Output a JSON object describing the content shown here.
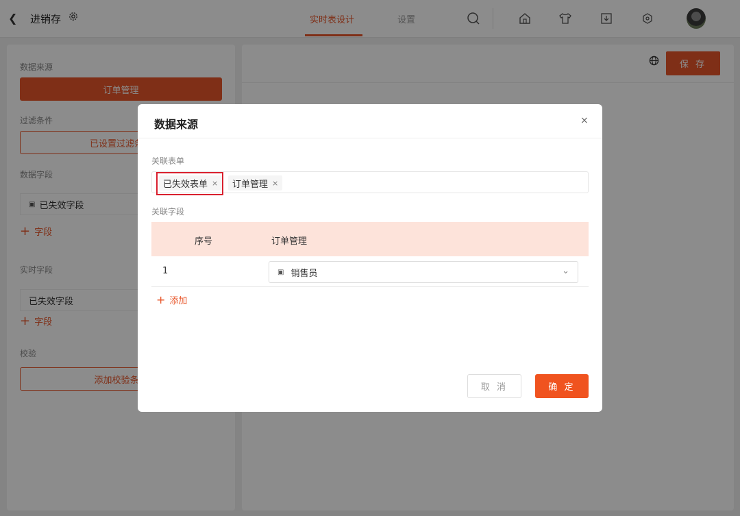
{
  "header": {
    "back_icon": "chevron-left",
    "title": "进销存",
    "settings_icon": "gear",
    "tabs": [
      {
        "label": "实时表设计",
        "active": true
      },
      {
        "label": "设置",
        "active": false
      }
    ],
    "icons": [
      "search",
      "home",
      "shirt",
      "download",
      "hexagon"
    ],
    "accent_color": "#e8562a"
  },
  "left_panel": {
    "data_source_label": "数据来源",
    "data_source_value": "订单管理",
    "filter_label": "过滤条件",
    "filter_button": "已设置过滤条件",
    "data_fields_label": "数据字段",
    "data_field_item": "已失效字段",
    "add_field_1": "字段",
    "realtime_fields_label": "实时字段",
    "realtime_field_item": "已失效字段",
    "add_field_2": "字段",
    "validation_label": "校验",
    "validation_button": "添加校验条件"
  },
  "right_panel": {
    "globe_icon": "globe",
    "save_label": "保 存"
  },
  "modal": {
    "title": "数据来源",
    "close": "×",
    "related_forms_label": "关联表单",
    "tags": [
      {
        "label": "已失效表单",
        "remove": "×"
      },
      {
        "label": "订单管理",
        "remove": "×"
      }
    ],
    "related_fields_label": "关联字段",
    "table": {
      "headers": [
        "序号",
        "订单管理"
      ],
      "rows": [
        {
          "index": "1",
          "field": "销售员"
        }
      ]
    },
    "add_label": "添加",
    "cancel_label": "取 消",
    "confirm_label": "确 定"
  }
}
